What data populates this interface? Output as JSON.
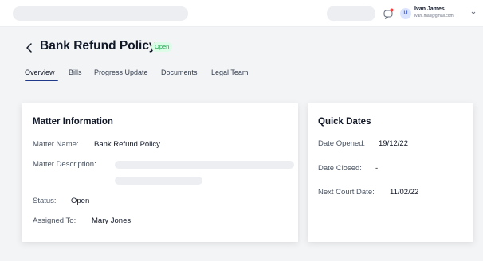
{
  "user": {
    "initials": "IJ",
    "name": "Ivan James",
    "email": "ivanl.mail@gmail.com"
  },
  "page": {
    "title": "Bank Refund Policy",
    "status": "Open"
  },
  "tabs": [
    {
      "label": "Overview",
      "active": true
    },
    {
      "label": "Bills",
      "active": false
    },
    {
      "label": "Progress Update",
      "active": false
    },
    {
      "label": "Documents",
      "active": false
    },
    {
      "label": "Legal Team",
      "active": false
    }
  ],
  "matter_info": {
    "title": "Matter Information",
    "matter_name_label": "Matter Name:",
    "matter_name": "Bank Refund Policy",
    "description_label": "Matter Description:",
    "status_label": "Status:",
    "status": "Open",
    "assigned_label": "Assigned To:",
    "assigned": "Mary Jones"
  },
  "quick_dates": {
    "title": "Quick Dates",
    "opened_label": "Date Opened:",
    "opened": "19/12/22",
    "closed_label": "Date Closed:",
    "closed": "-",
    "court_label": "Next Court Date:",
    "court": "11/02/22"
  },
  "colors": {
    "accent": "#1f3a8a",
    "status_bg": "#dcfce7",
    "status_text": "#16a34a"
  },
  "icons": [
    "back-chevron-icon",
    "notification-icon",
    "chevron-down-icon"
  ]
}
